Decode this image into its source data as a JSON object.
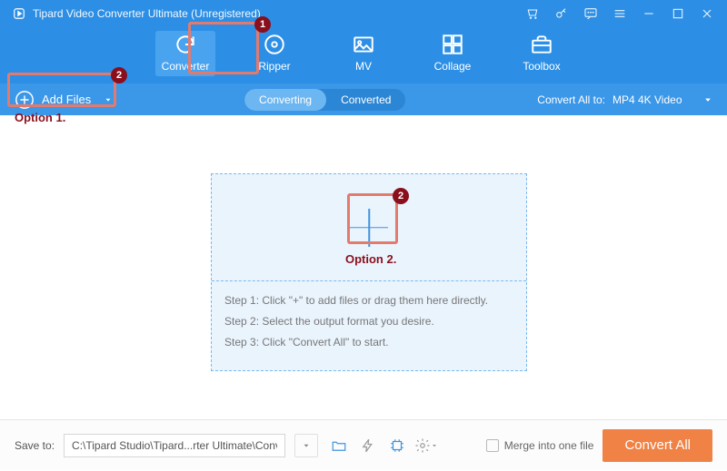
{
  "title": "Tipard Video Converter Ultimate (Unregistered)",
  "tabs": {
    "converter": "Converter",
    "ripper": "Ripper",
    "mv": "MV",
    "collage": "Collage",
    "toolbox": "Toolbox"
  },
  "addFiles": "Add Files",
  "seg": {
    "converting": "Converting",
    "converted": "Converted"
  },
  "convertAllTo": {
    "label": "Convert All to:",
    "value": "MP4 4K Video"
  },
  "steps": {
    "s1": "Step 1: Click \"+\" to add files or drag them here directly.",
    "s2": "Step 2: Select the output format you desire.",
    "s3": "Step 3: Click \"Convert All\" to start."
  },
  "footer": {
    "saveToLabel": "Save to:",
    "path": "C:\\Tipard Studio\\Tipard...rter Ultimate\\Converted",
    "merge": "Merge into one file",
    "convert": "Convert All"
  },
  "anno": {
    "badge1": "1",
    "badge2": "2",
    "opt1": "Option 1.",
    "opt2": "Option 2."
  }
}
